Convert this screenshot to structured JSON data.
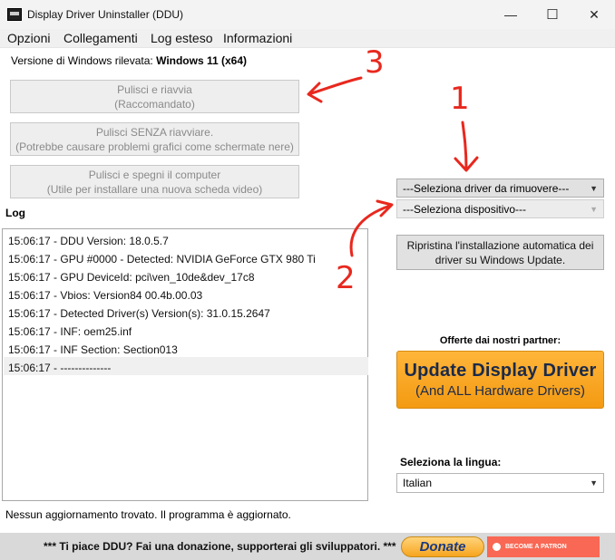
{
  "window": {
    "title": "Display Driver Uninstaller (DDU)",
    "minimize": "—",
    "maximize": "☐",
    "close": "✕"
  },
  "menu": [
    "Opzioni",
    "Collegamenti",
    "Log esteso",
    "Informazioni"
  ],
  "windows_version": {
    "label": "Versione di Windows rilevata:",
    "value": "Windows 11 (x64)"
  },
  "buttons": {
    "clean_restart": {
      "line1": "Pulisci e riavvia",
      "line2": "(Raccomandato)"
    },
    "clean_no_restart": {
      "line1": "Pulisci SENZA riavviare.",
      "line2": "(Potrebbe causare problemi grafici come schermate nere)"
    },
    "clean_shutdown": {
      "line1": "Pulisci e spegni il computer",
      "line2": "(Utile per installare una nuova scheda video)"
    },
    "restore_windows_update": {
      "line1": "Ripristina l'installazione automatica dei",
      "line2": "driver su Windows Update."
    }
  },
  "selects": {
    "driver": "---Seleziona driver da rimuovere---",
    "device": "---Seleziona dispositivo---",
    "language": "Italian"
  },
  "log": {
    "label": "Log",
    "lines": [
      "15:06:17 - DDU Version: 18.0.5.7",
      "15:06:17 - GPU #0000 - Detected: NVIDIA GeForce GTX 980 Ti",
      "15:06:17 - GPU DeviceId: pci\\ven_10de&dev_17c8",
      "15:06:17 - Vbios: Version84 00.4b.00.03",
      "15:06:17 - Detected Driver(s) Version(s): 31.0.15.2647",
      "15:06:17 - INF: oem25.inf",
      "15:06:17 - INF Section: Section013",
      "15:06:17 - --------------"
    ]
  },
  "partners": {
    "label": "Offerte dai nostri partner:",
    "banner_title": "Update Display Driver",
    "banner_sub": "(And ALL Hardware Drivers)"
  },
  "language_label": "Seleziona la lingua:",
  "status": "Nessun aggiornamento trovato. Il programma è aggiornato.",
  "footer": {
    "message": "*** Ti piace DDU? Fai una donazione, supporterai gli sviluppatori. ***",
    "donate": "Donate",
    "patron": "BECOME A PATRON"
  },
  "annotations": [
    "3",
    "1",
    "2"
  ],
  "colors": {
    "annotation": "#e8281e",
    "banner": "#f39a12",
    "patron": "#f96854"
  }
}
